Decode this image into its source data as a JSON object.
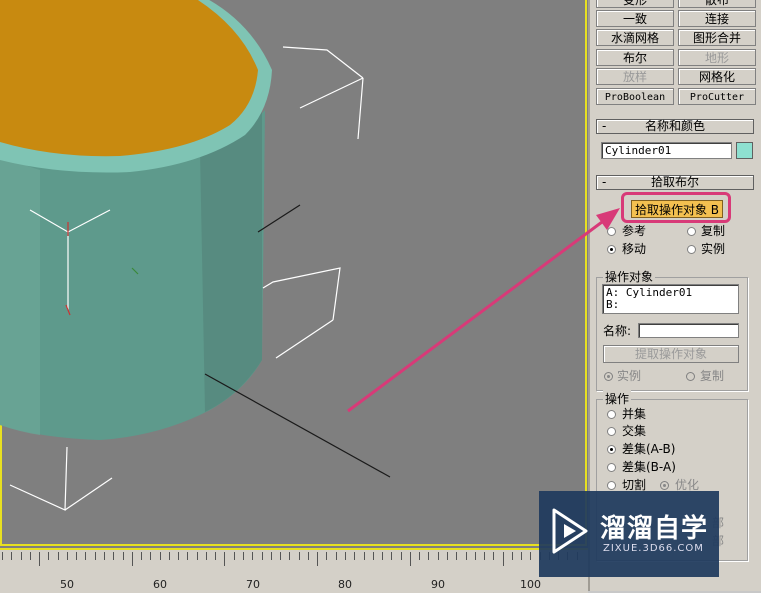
{
  "panel": {
    "top_buttons": [
      {
        "label": "变形",
        "dim": false
      },
      {
        "label": "散布",
        "dim": false
      },
      {
        "label": "一致",
        "dim": false
      },
      {
        "label": "连接",
        "dim": false
      },
      {
        "label": "水滴网格",
        "dim": false
      },
      {
        "label": "图形合并",
        "dim": false
      },
      {
        "label": "布尔",
        "dim": false
      },
      {
        "label": "地形",
        "dim": true
      },
      {
        "label": "放样",
        "dim": true
      },
      {
        "label": "网格化",
        "dim": false
      },
      {
        "label": "ProBoolean",
        "dim": false
      },
      {
        "label": "ProCutter",
        "dim": false
      }
    ],
    "name_color": {
      "rollout_title": "名称和颜色",
      "object_name": "Cylinder01",
      "swatch_color": "#8ee0d0"
    },
    "pick_boolean": {
      "rollout_title": "拾取布尔",
      "pick_button": "拾取操作对象 B",
      "reference": "参考",
      "copy": "复制",
      "move": "移动",
      "instance": "实例"
    },
    "operands": {
      "group_title": "操作对象",
      "line_a": "A: Cylinder01",
      "line_b": "B:",
      "name_label": "名称:",
      "name_value": "",
      "extract_button": "提取操作对象",
      "instance": "实例",
      "copy": "复制"
    },
    "operation": {
      "group_title": "操作",
      "union": "并集",
      "intersection": "交集",
      "subtraction_ab": "差集(A-B)",
      "subtraction_ba": "差集(B-A)",
      "cut": "切割",
      "refine": "优化",
      "partial_1": "部",
      "partial_2": "部"
    }
  },
  "ruler": {
    "labels": [
      "50",
      "60",
      "70",
      "80",
      "90",
      "100"
    ]
  },
  "watermark": {
    "title": "溜溜自学",
    "url": "ZIXUE.3D66.COM"
  },
  "colors": {
    "viewport_bg": "#7f7f7f",
    "cylinder_side": "#5e9a8c",
    "cylinder_top": "#c88a10",
    "cylinder_rim": "#7fc4b4",
    "highlight": "#d83a78",
    "selection_border": "#e8e020"
  }
}
